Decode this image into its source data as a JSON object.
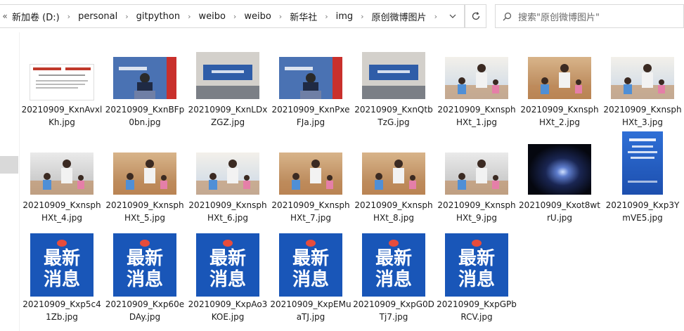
{
  "address_bar": {
    "more": "«",
    "crumbs": [
      "新加卷 (D:)",
      "personal",
      "gitpython",
      "weibo",
      "weibo",
      "新华社",
      "img",
      "原创微博图片"
    ]
  },
  "search": {
    "placeholder": "搜索\"原创微博图片\""
  },
  "files": [
    {
      "name": "20210909_KxnAvxlKh.jpg",
      "thumb": "doc"
    },
    {
      "name": "20210909_KxnBFp0bn.jpg",
      "thumb": "press"
    },
    {
      "name": "20210909_KxnLDxZGZ.jpg",
      "thumb": "hall"
    },
    {
      "name": "20210909_KxnPxeFJa.jpg",
      "thumb": "press"
    },
    {
      "name": "20210909_KxnQtbTzG.jpg",
      "thumb": "hall"
    },
    {
      "name": "20210909_KxnsphHXt_1.jpg",
      "thumb": "kid1"
    },
    {
      "name": "20210909_KxnsphHXt_2.jpg",
      "thumb": "kid2"
    },
    {
      "name": "20210909_KxnsphHXt_3.jpg",
      "thumb": "kid1"
    },
    {
      "name": "20210909_KxnsphHXt_4.jpg",
      "thumb": "kid3"
    },
    {
      "name": "20210909_KxnsphHXt_5.jpg",
      "thumb": "kid2"
    },
    {
      "name": "20210909_KxnsphHXt_6.jpg",
      "thumb": "kid1"
    },
    {
      "name": "20210909_KxnsphHXt_7.jpg",
      "thumb": "kid2"
    },
    {
      "name": "20210909_KxnsphHXt_8.jpg",
      "thumb": "kid2"
    },
    {
      "name": "20210909_KxnsphHXt_9.jpg",
      "thumb": "kid3"
    },
    {
      "name": "20210909_Kxot8wtrU.jpg",
      "thumb": "galaxy"
    },
    {
      "name": "20210909_Kxp3YmVE5.jpg",
      "thumb": "bluebook"
    },
    {
      "name": "20210909_Kxp5c41Zb.jpg",
      "thumb": "news",
      "overlay": [
        "最新",
        "消息"
      ]
    },
    {
      "name": "20210909_Kxp60eDAy.jpg",
      "thumb": "news",
      "overlay": [
        "最新",
        "消息"
      ]
    },
    {
      "name": "20210909_KxpAo3KOE.jpg",
      "thumb": "news",
      "overlay": [
        "最新",
        "消息"
      ]
    },
    {
      "name": "20210909_KxpEMuaTJ.jpg",
      "thumb": "news",
      "overlay": [
        "最新",
        "消息"
      ]
    },
    {
      "name": "20210909_KxpG0DTj7.jpg",
      "thumb": "news",
      "overlay": [
        "最新",
        "消息"
      ]
    },
    {
      "name": "20210909_KxpGPbRCV.jpg",
      "thumb": "news",
      "overlay": [
        "最新",
        "消息"
      ]
    }
  ]
}
